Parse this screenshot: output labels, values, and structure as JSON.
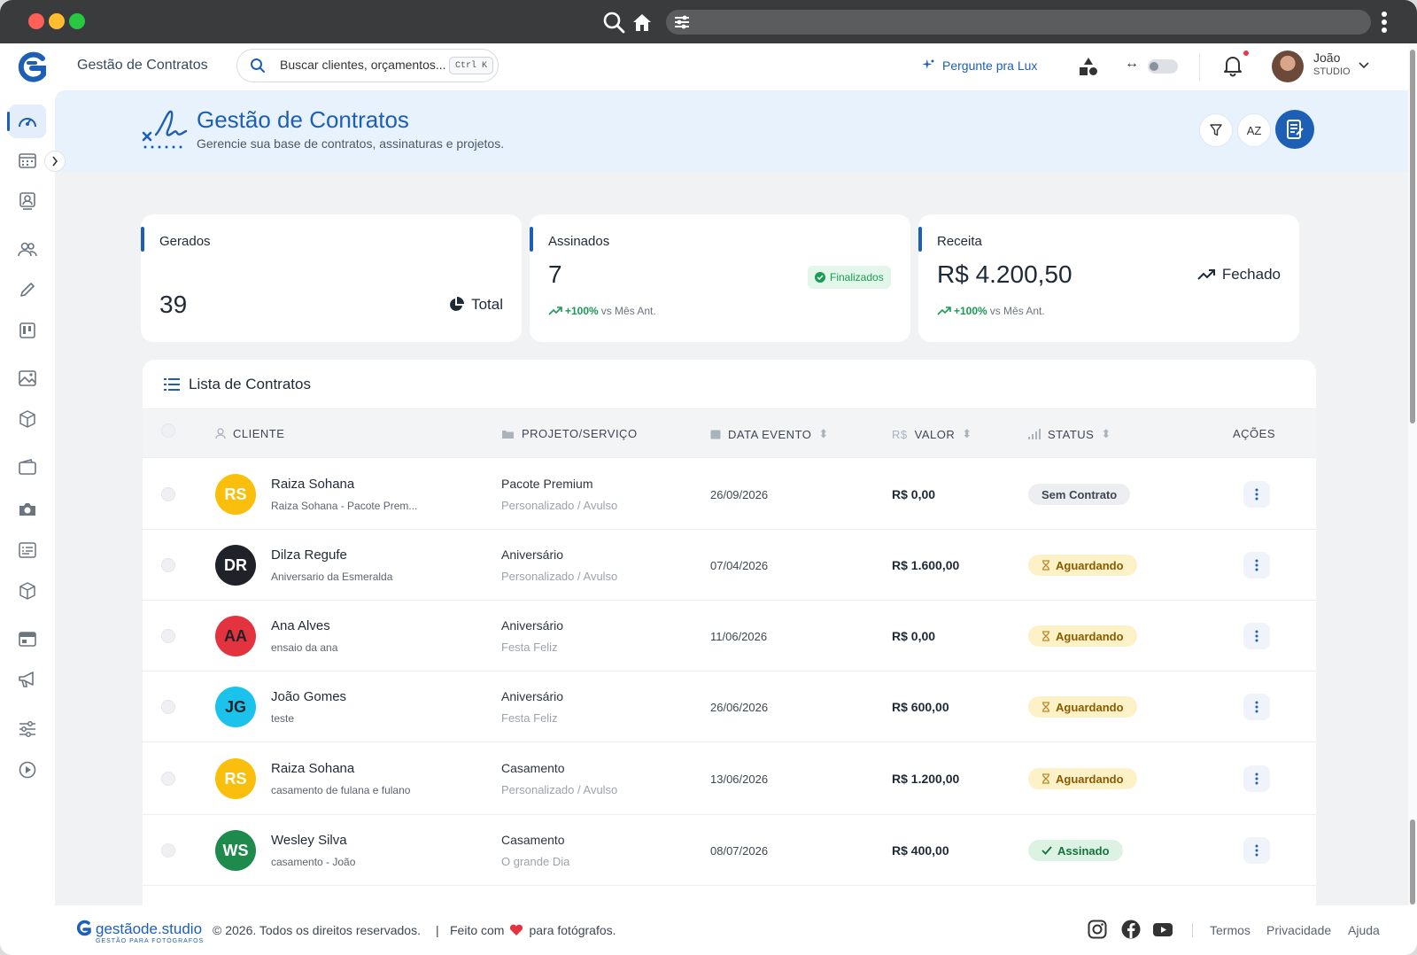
{
  "app": {
    "title": "Gestão de Contratos"
  },
  "search": {
    "placeholder": "Buscar clientes, orçamentos...",
    "shortcut": "Ctrl K"
  },
  "topbar": {
    "ask_label": "Pergunte pra Lux",
    "user_name": "João",
    "user_plan": "STUDIO"
  },
  "hero": {
    "title": "Gestão de Contratos",
    "subtitle": "Gerencie sua base de contratos, assinaturas e projetos.",
    "sort_label": "AZ"
  },
  "stats": [
    {
      "title": "Gerados",
      "value": "39",
      "side_label": "Total"
    },
    {
      "title": "Assinados",
      "value": "7",
      "badge": "Finalizados",
      "trend_pct": "+100%",
      "trend_text": "vs Mês Ant."
    },
    {
      "title": "Receita",
      "value": "R$ 4.200,50",
      "side_label": "Fechado",
      "trend_pct": "+100%",
      "trend_text": "vs Mês Ant."
    }
  ],
  "list": {
    "title": "Lista de Contratos",
    "columns": {
      "client": "CLIENTE",
      "project": "PROJETO/SERVIÇO",
      "date": "DATA EVENTO",
      "value_prefix": "R$",
      "value": "VALOR",
      "status": "STATUS",
      "actions": "AÇÕES"
    },
    "rows": [
      {
        "initials": "RS",
        "color": "#f9bf0c",
        "text_color": "#ffffff",
        "client": "Raiza Sohana",
        "client_sub": "Raiza Sohana - Pacote Prem...",
        "project": "Pacote Premium",
        "project_sub": "Personalizado / Avulso",
        "date": "26/09/2026",
        "value": "R$ 0,00",
        "status": "Sem Contrato",
        "status_type": "none"
      },
      {
        "initials": "DR",
        "color": "#1f2329",
        "text_color": "#ffffff",
        "client": "Dilza Regufe",
        "client_sub": "Aniversario da Esmeralda",
        "project": "Aniversário",
        "project_sub": "Personalizado / Avulso",
        "date": "07/04/2026",
        "value": "R$ 1.600,00",
        "status": "Aguardando",
        "status_type": "wait"
      },
      {
        "initials": "AA",
        "color": "#e3333f",
        "text_color": "#1f2329",
        "client": "Ana Alves",
        "client_sub": "ensaio da ana",
        "project": "Aniversário",
        "project_sub": "Festa Feliz",
        "date": "11/06/2026",
        "value": "R$ 0,00",
        "status": "Aguardando",
        "status_type": "wait"
      },
      {
        "initials": "JG",
        "color": "#1bc3ec",
        "text_color": "#1f2329",
        "client": "João Gomes",
        "client_sub": "teste",
        "project": "Aniversário",
        "project_sub": "Festa Feliz",
        "date": "26/06/2026",
        "value": "R$ 600,00",
        "status": "Aguardando",
        "status_type": "wait"
      },
      {
        "initials": "RS",
        "color": "#f9bf0c",
        "text_color": "#ffffff",
        "client": "Raiza Sohana",
        "client_sub": "casamento de fulana e fulano",
        "project": "Casamento",
        "project_sub": "Personalizado / Avulso",
        "date": "13/06/2026",
        "value": "R$ 1.200,00",
        "status": "Aguardando",
        "status_type": "wait"
      },
      {
        "initials": "WS",
        "color": "#1e8a4c",
        "text_color": "#ffffff",
        "client": "Wesley Silva",
        "client_sub": "casamento - João",
        "project": "Casamento",
        "project_sub": "O grande Dia",
        "date": "08/07/2026",
        "value": "R$ 400,00",
        "status": "Assinado",
        "status_type": "ok"
      }
    ]
  },
  "footer": {
    "brand": "gestãode.studio",
    "tagline": "GESTÃO PARA FOTÓGRAFOS",
    "copyright": "© 2026. Todos os direitos reservados.",
    "separator": "|",
    "made_prefix": "Feito com",
    "made_suffix": "para fotógrafos.",
    "links": [
      "Termos",
      "Privacidade",
      "Ajuda"
    ]
  },
  "colors": {
    "brand": "#1d5fb5",
    "success": "#1a9a55",
    "warning_bg": "#fdf1c8",
    "danger": "#e53946"
  },
  "icons": {
    "sidebar": [
      "dashboard-icon",
      "calendar-icon",
      "contacts-icon",
      "users-icon",
      "pencil-icon",
      "kanban-icon",
      "image-icon",
      "box-icon",
      "wallet-icon",
      "camera-icon",
      "forms-icon",
      "package-icon",
      "agenda-icon",
      "megaphone-icon",
      "settings-sliders-icon",
      "play-icon"
    ]
  }
}
